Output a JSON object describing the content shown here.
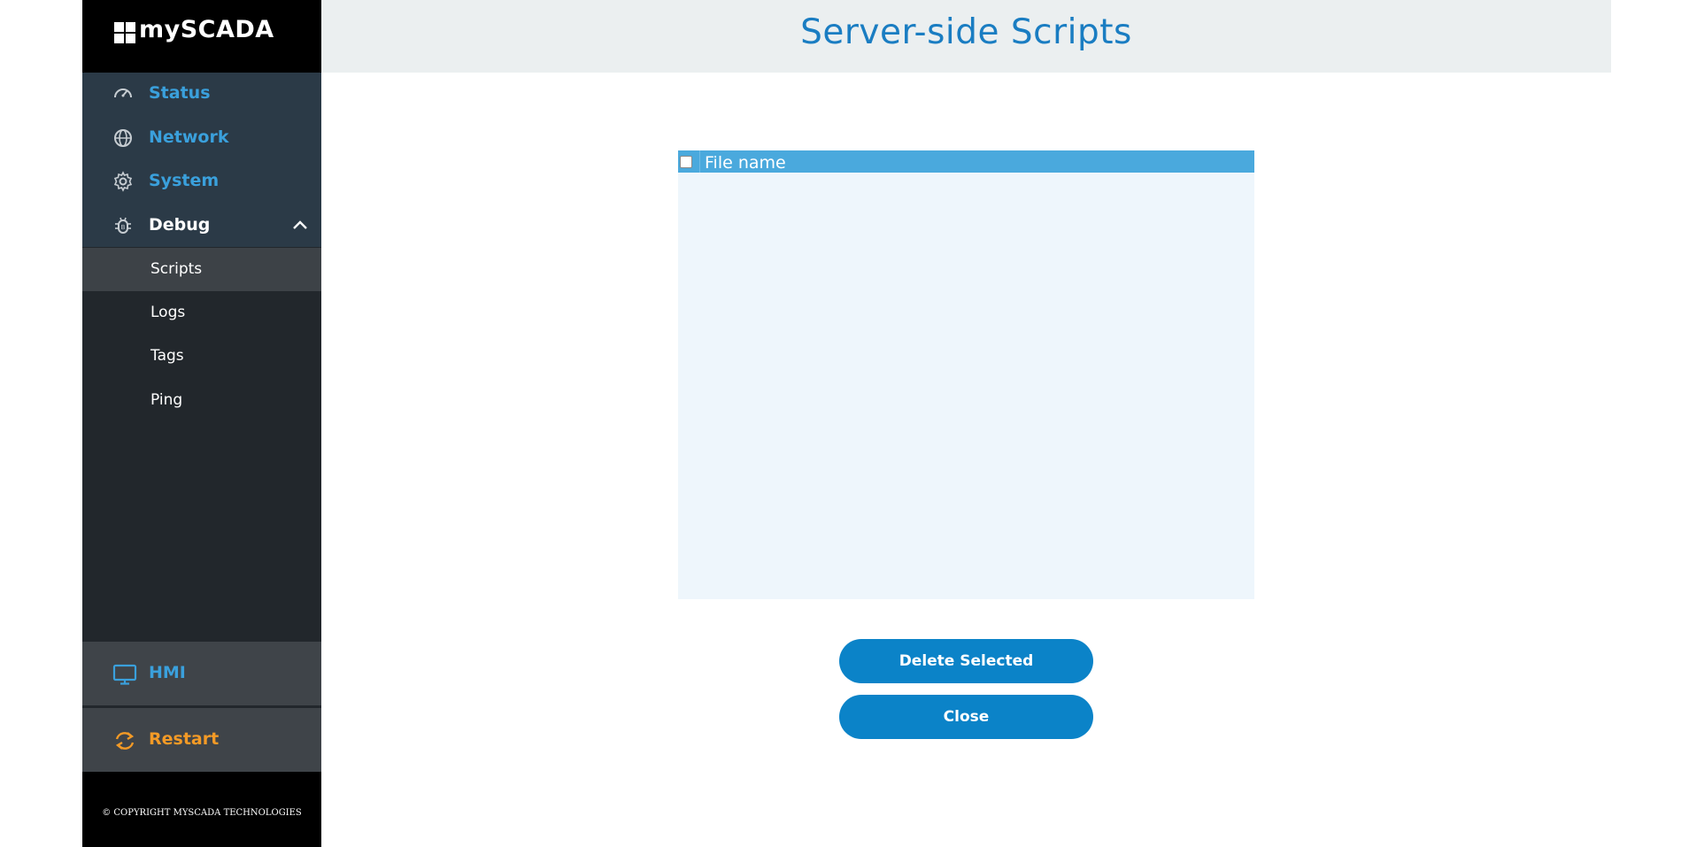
{
  "app": {
    "logo_text": "mySCADA"
  },
  "sidebar": {
    "items": [
      {
        "label": "Status",
        "icon": "speedometer-icon"
      },
      {
        "label": "Network",
        "icon": "globe-icon"
      },
      {
        "label": "System",
        "icon": "gear-icon"
      },
      {
        "label": "Debug",
        "icon": "bug-icon",
        "expanded": true
      }
    ],
    "debug_subitems": [
      {
        "label": "Scripts",
        "selected": true
      },
      {
        "label": "Logs"
      },
      {
        "label": "Tags"
      },
      {
        "label": "Ping"
      }
    ],
    "hmi_label": "HMI",
    "restart_label": "Restart",
    "copyright": "© COPYRIGHT MYSCADA TECHNOLOGIES"
  },
  "header": {
    "title": "Server-side Scripts"
  },
  "table": {
    "columns": [
      "File name"
    ],
    "rows": []
  },
  "actions": {
    "delete_label": "Delete Selected",
    "close_label": "Close"
  },
  "colors": {
    "accent_blue": "#1a7dc2",
    "nav_blue": "#3aa0dc",
    "restart_orange": "#f39a26",
    "button_blue": "#0b83c8",
    "table_header": "#4aa9dd",
    "table_body": "#eef6fc"
  }
}
